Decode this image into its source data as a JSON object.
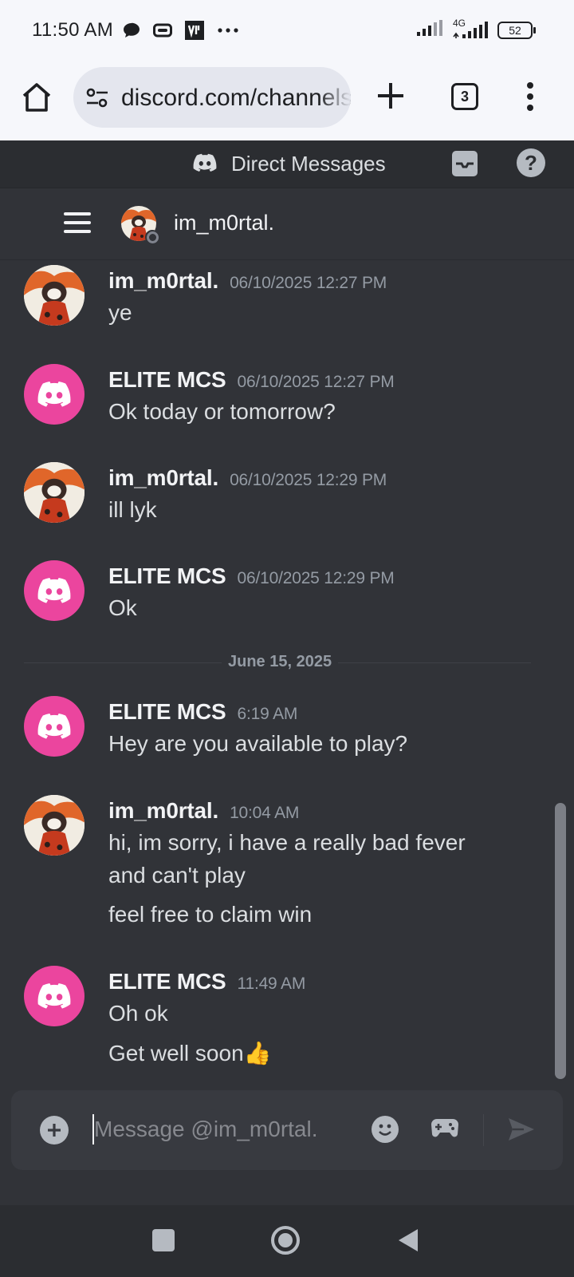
{
  "status_bar": {
    "time": "11:50 AM",
    "battery": "52",
    "network": "4G"
  },
  "browser": {
    "url": "discord.com/channels/@me",
    "tab_count": "3"
  },
  "discord": {
    "section_title": "Direct Messages",
    "channel_name": "im_m0rtal.",
    "date_divider": "June 15, 2025",
    "messages": [
      {
        "author": "im_m0rtal.",
        "timestamp": "06/10/2025 12:27 PM",
        "lines": [
          "ye"
        ]
      },
      {
        "author": "ELITE MCS",
        "timestamp": "06/10/2025 12:27 PM",
        "lines": [
          "Ok today or tomorrow?"
        ]
      },
      {
        "author": "im_m0rtal.",
        "timestamp": "06/10/2025 12:29 PM",
        "lines": [
          "ill lyk"
        ]
      },
      {
        "author": "ELITE MCS",
        "timestamp": "06/10/2025 12:29 PM",
        "lines": [
          "Ok"
        ]
      },
      {
        "author": "ELITE MCS",
        "timestamp": "6:19 AM",
        "lines": [
          "Hey are you available to play?"
        ]
      },
      {
        "author": "im_m0rtal.",
        "timestamp": "10:04 AM",
        "lines": [
          "hi, im sorry, i have a really bad fever",
          "and can't play",
          "feel free to claim win"
        ]
      },
      {
        "author": "ELITE MCS",
        "timestamp": "11:49 AM",
        "lines": [
          "Oh ok",
          "Get well soon👍"
        ]
      }
    ],
    "composer_placeholder": "Message @im_m0rtal."
  },
  "colors": {
    "discord_pink": "#eb459e",
    "background": "#313338",
    "header": "#2b2d31"
  }
}
